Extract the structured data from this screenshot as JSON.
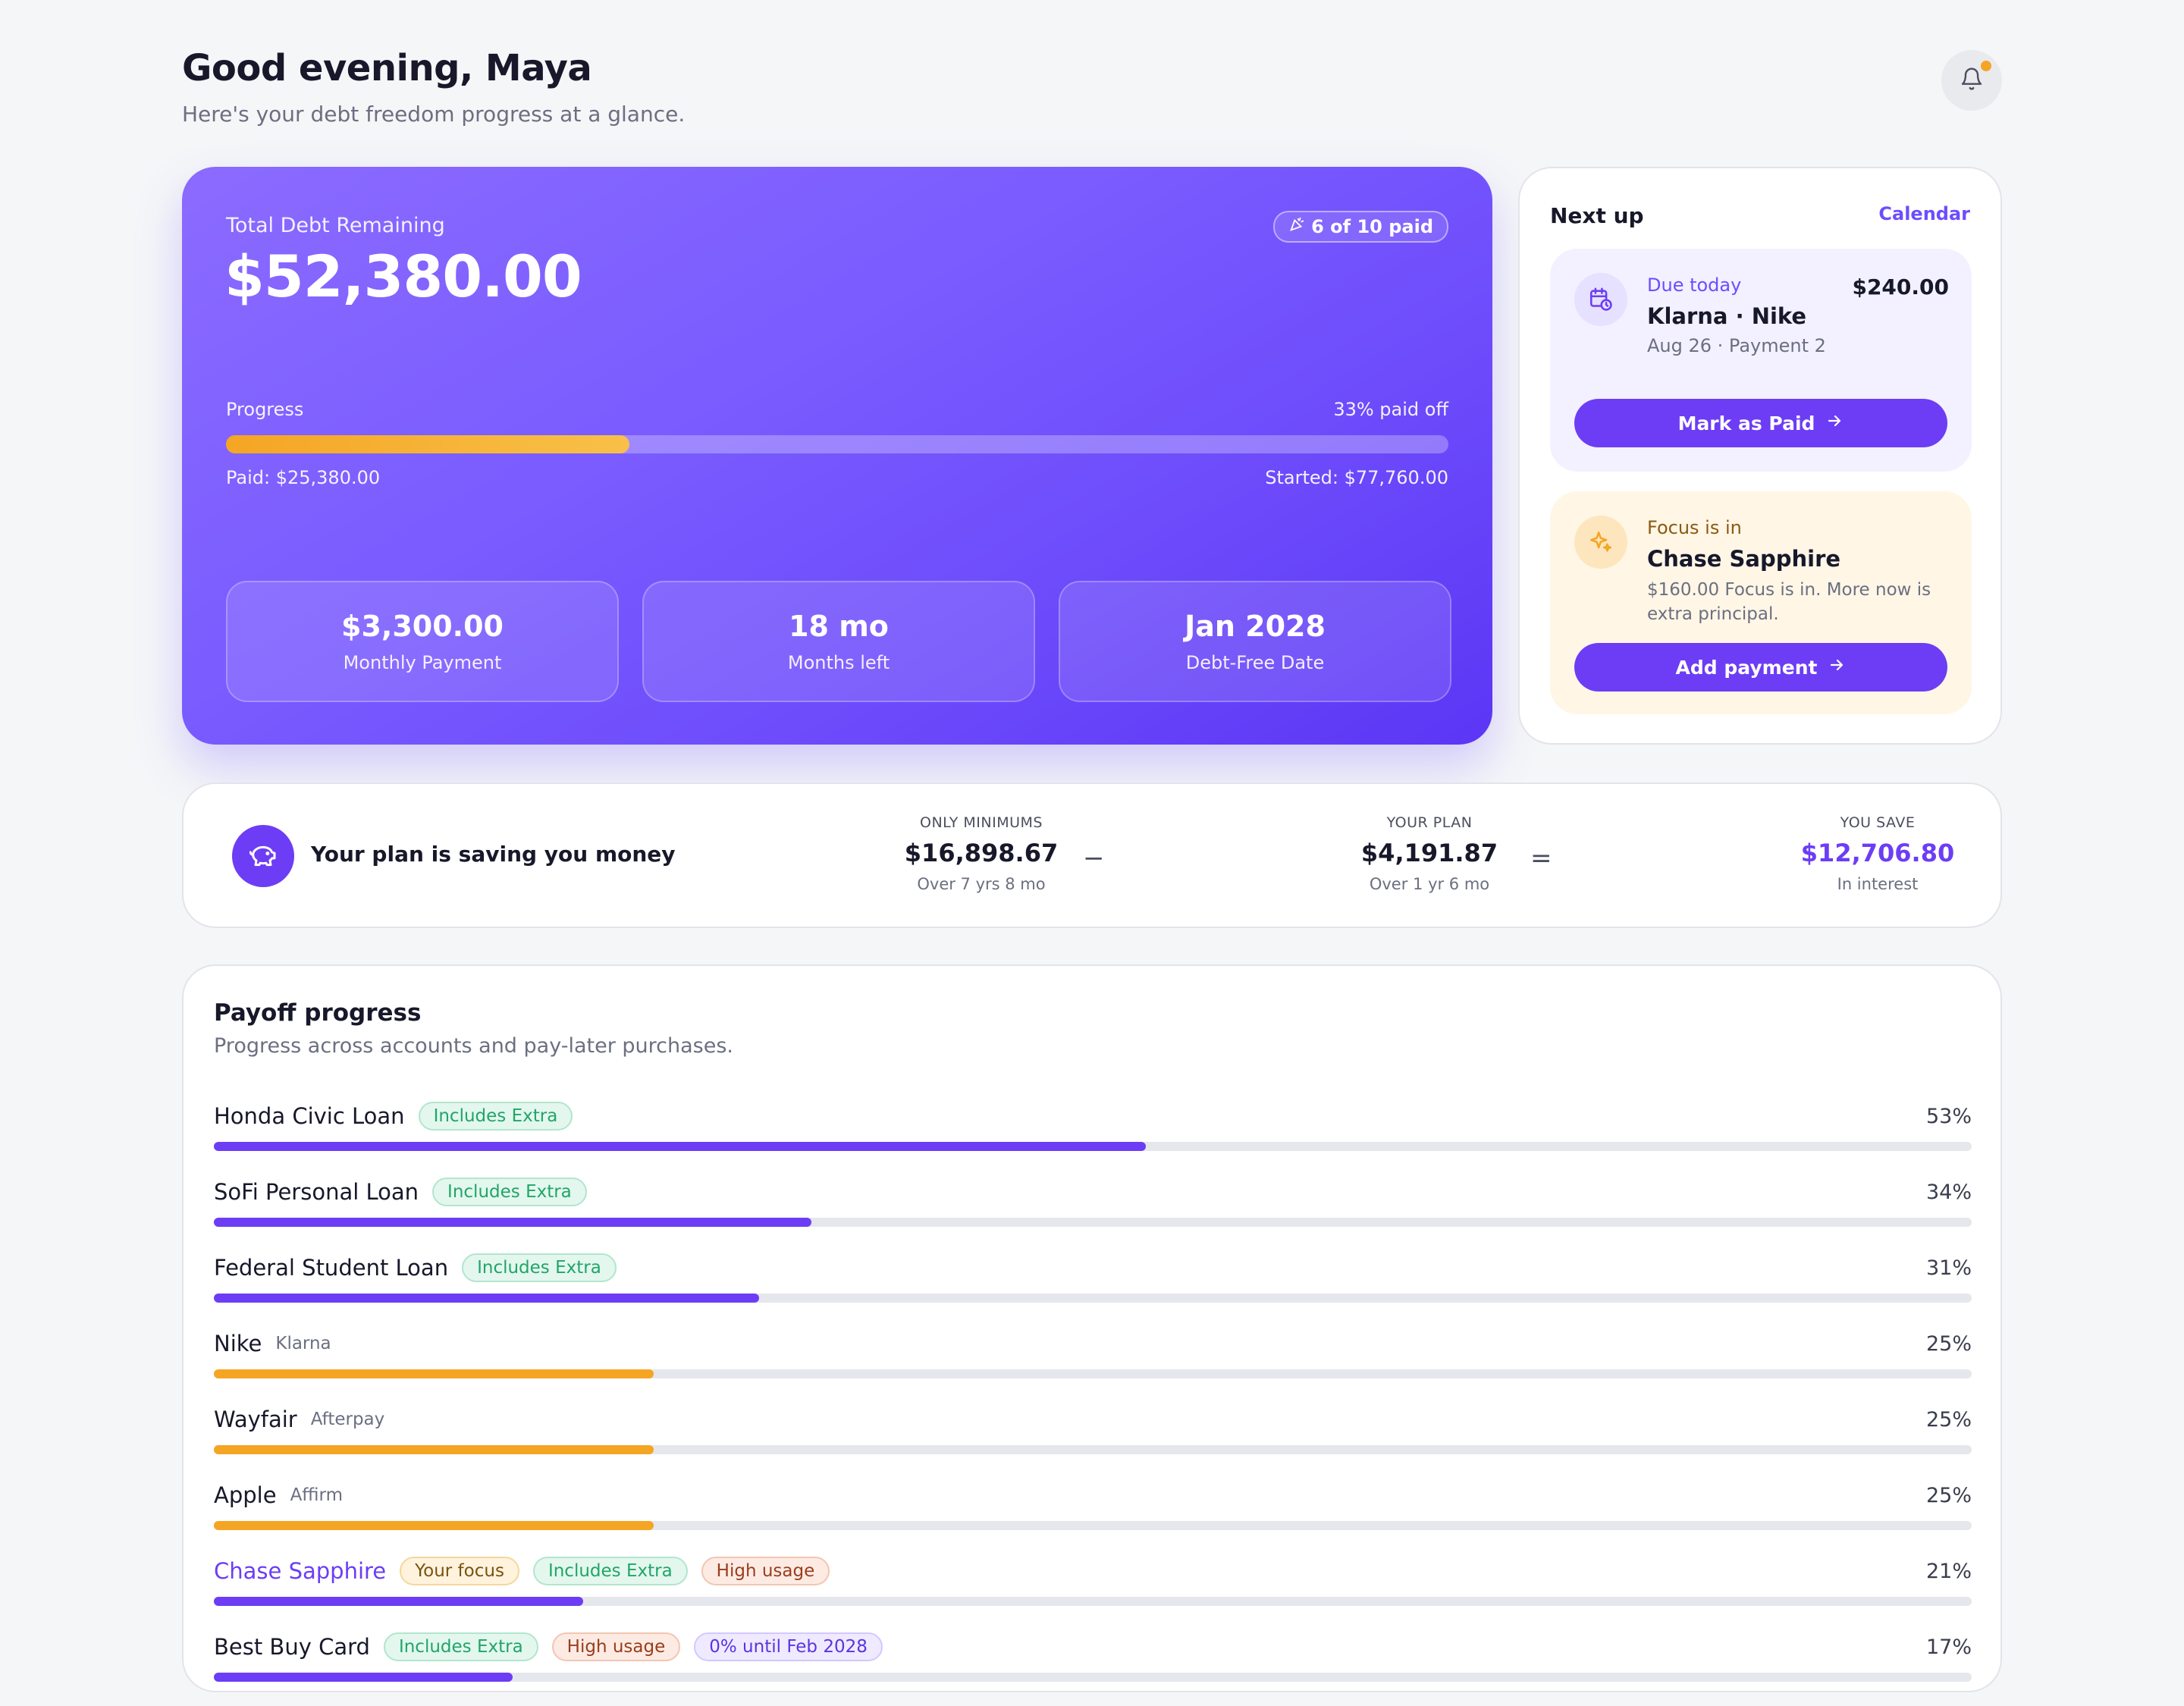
{
  "header": {
    "greeting": "Good evening, Maya",
    "subtitle": "Here's your debt freedom progress at a glance.",
    "notification_icon": "bell-icon"
  },
  "hero": {
    "label": "Total Debt Remaining",
    "amount": "$52,380.00",
    "badge": "6 of 10 paid",
    "progress_label": "Progress",
    "progress_pct_text": "33% paid off",
    "progress_fraction": 0.33,
    "paid_text": "Paid: $25,380.00",
    "started_text": "Started: $77,760.00",
    "stats": [
      {
        "value": "$3,300.00",
        "label": "Monthly Payment"
      },
      {
        "value": "18 mo",
        "label": "Months left"
      },
      {
        "value": "Jan 2028",
        "label": "Debt-Free Date"
      }
    ]
  },
  "next_up": {
    "title": "Next up",
    "calendar_link": "Calendar",
    "due": {
      "tag": "Due today",
      "name": "Klarna · Nike",
      "meta": "Aug 26 · Payment 2",
      "amount": "$240.00",
      "button": "Mark as Paid"
    },
    "focus": {
      "tag": "Focus is in",
      "name": "Chase Sapphire",
      "desc": "$160.00 Focus is in. More now is extra principal.",
      "button": "Add payment"
    }
  },
  "savings": {
    "title": "Your plan is saving you money",
    "minimums": {
      "caption": "ONLY MINIMUMS",
      "value": "$16,898.67",
      "note": "Over 7 yrs 8 mo"
    },
    "minus": "−",
    "plan": {
      "caption": "YOUR PLAN",
      "value": "$4,191.87",
      "note": "Over 1 yr 6 mo"
    },
    "equals": "=",
    "save": {
      "caption": "YOU SAVE",
      "value": "$12,706.80",
      "note": "In interest"
    }
  },
  "payoff": {
    "title": "Payoff progress",
    "subtitle": "Progress across accounts and pay-later purchases.",
    "colors": {
      "loan": "#6c3df5",
      "bnpl": "#f5a524"
    },
    "rows": [
      {
        "name": "Honda Civic Loan",
        "sub": "",
        "tags": [
          "Includes Extra"
        ],
        "pct": "53%",
        "fraction": 0.53,
        "kind": "loan"
      },
      {
        "name": "SoFi Personal Loan",
        "sub": "",
        "tags": [
          "Includes Extra"
        ],
        "pct": "34%",
        "fraction": 0.34,
        "kind": "loan"
      },
      {
        "name": "Federal Student Loan",
        "sub": "",
        "tags": [
          "Includes Extra"
        ],
        "pct": "31%",
        "fraction": 0.31,
        "kind": "loan"
      },
      {
        "name": "Nike",
        "sub": "Klarna",
        "tags": [],
        "pct": "25%",
        "fraction": 0.25,
        "kind": "bnpl"
      },
      {
        "name": "Wayfair",
        "sub": "Afterpay",
        "tags": [],
        "pct": "25%",
        "fraction": 0.25,
        "kind": "bnpl"
      },
      {
        "name": "Apple",
        "sub": "Affirm",
        "tags": [],
        "pct": "25%",
        "fraction": 0.25,
        "kind": "bnpl"
      },
      {
        "name": "Chase Sapphire",
        "sub": "",
        "tags": [
          "Your focus",
          "Includes Extra",
          "High usage"
        ],
        "pct": "21%",
        "fraction": 0.21,
        "kind": "loan",
        "focus": true
      },
      {
        "name": "Best Buy Card",
        "sub": "",
        "tags": [
          "Includes Extra",
          "High usage",
          "0% until Feb 2028"
        ],
        "pct": "17%",
        "fraction": 0.17,
        "kind": "loan"
      }
    ]
  }
}
